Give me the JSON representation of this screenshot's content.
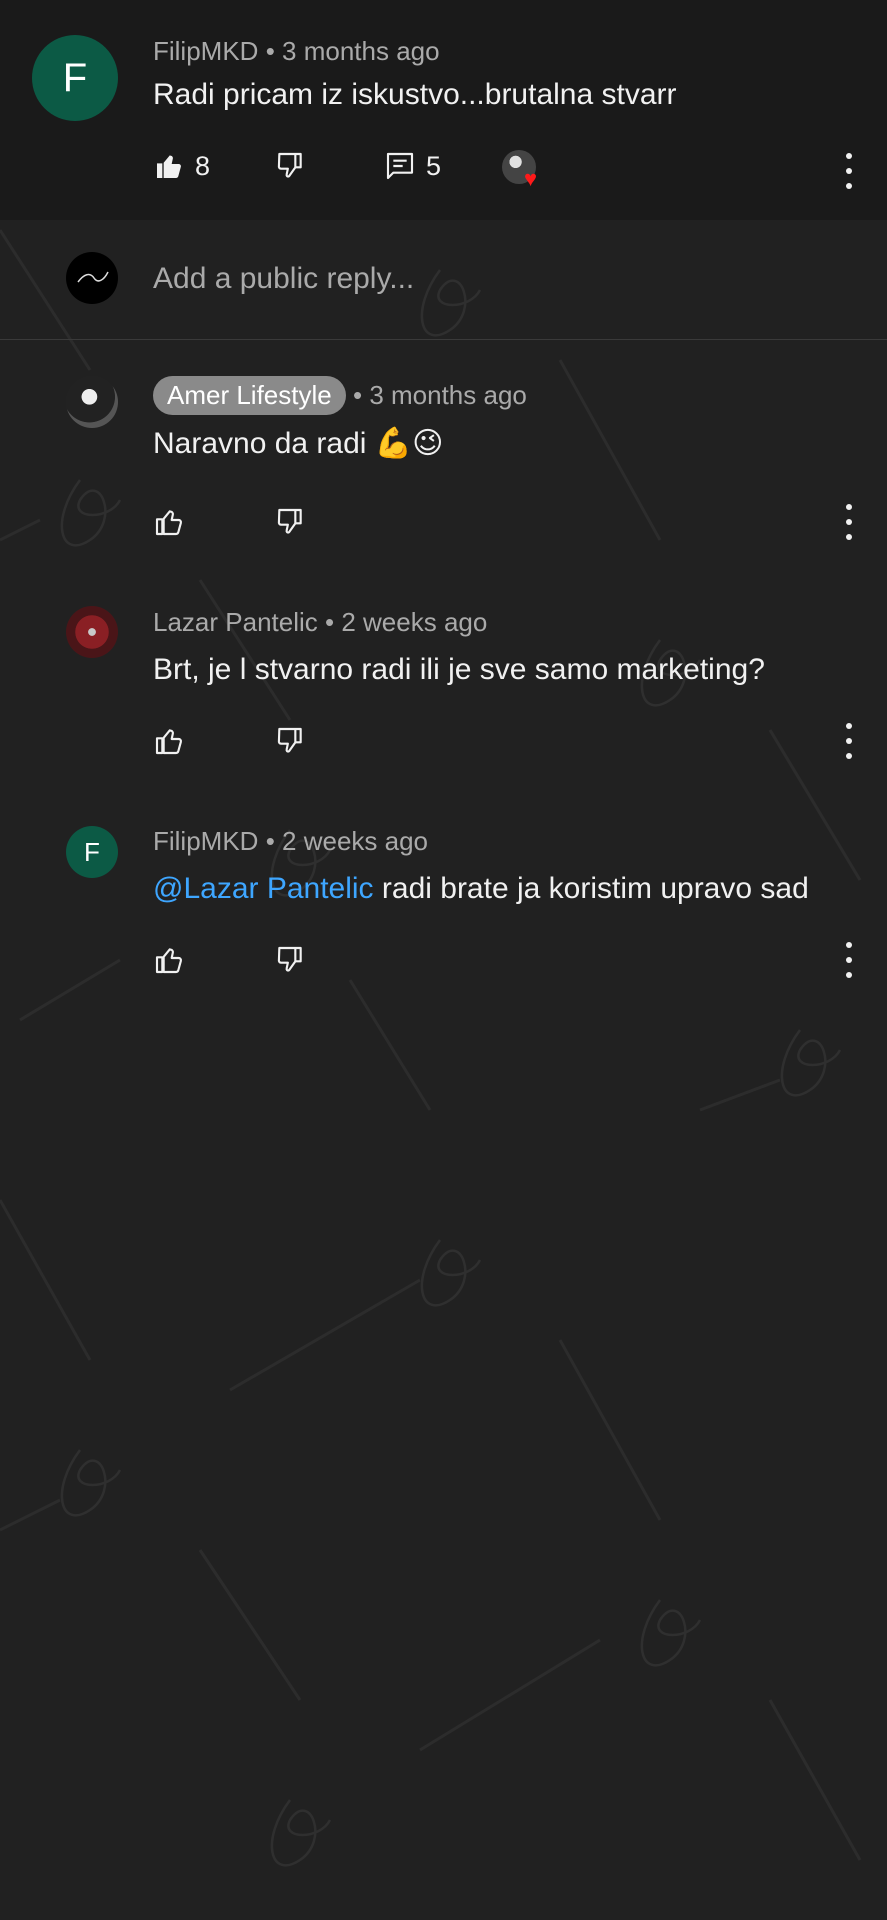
{
  "parent_comment": {
    "avatar_letter": "F",
    "author": "FilipMKD",
    "time": "3 months ago",
    "text": "Radi pricam iz iskustvo...brutalna stvarr",
    "likes": "8",
    "replies": "5"
  },
  "reply_box": {
    "placeholder": "Add a public reply..."
  },
  "replies": [
    {
      "author": "Amer Lifestyle",
      "time": "3 months ago",
      "text": "Naravno da radi 💪😉"
    },
    {
      "author": "Lazar Pantelic",
      "time": "2 weeks ago",
      "text": "Brt, je l stvarno radi ili je sve samo marketing?"
    },
    {
      "avatar_letter": "F",
      "author": "FilipMKD",
      "time": "2 weeks ago",
      "mention": "@Lazar Pantelic",
      "text": " radi brate ja koristim upravo sad"
    }
  ],
  "separator": "•",
  "icons": {
    "like": "thumbs-up-icon",
    "dislike": "thumbs-down-icon",
    "reply": "comment-icon",
    "more": "more-vert-icon",
    "heart": "heart-icon"
  },
  "colors": {
    "background": "#212121",
    "parent_background": "#1a1a1a",
    "avatar_green": "#0c5a45",
    "mention_blue": "#3ea6ff",
    "heart_red": "#ff1a1a",
    "chip_gray": "#8a8a8a"
  }
}
